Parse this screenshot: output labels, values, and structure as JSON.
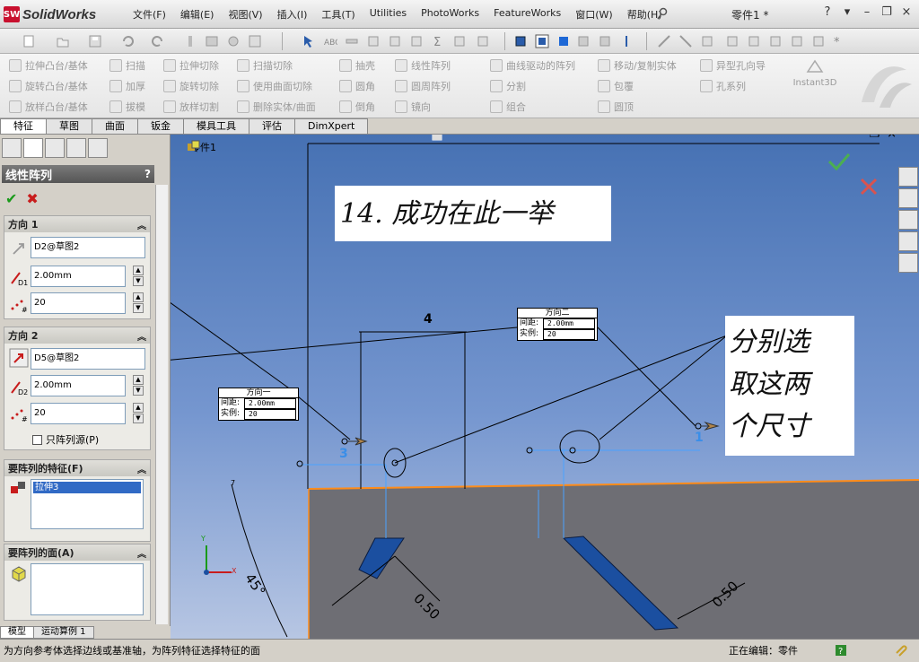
{
  "app": {
    "logo_mark": "SW",
    "logo_text": "SolidWorks",
    "doc_title": "零件1 *",
    "menu": [
      "文件(F)",
      "编辑(E)",
      "视图(V)",
      "插入(I)",
      "工具(T)",
      "Utilities",
      "PhotoWorks",
      "FeatureWorks",
      "窗口(W)",
      "帮助(H)"
    ],
    "window_controls": [
      "?",
      "▾",
      "–",
      "❐",
      "×"
    ]
  },
  "commands": {
    "col1": [
      "拉伸凸台/基体",
      "旋转凸台/基体",
      "放样凸台/基体"
    ],
    "col2": [
      "扫描",
      "加厚",
      "拔模"
    ],
    "col3": [
      "拉伸切除",
      "旋转切除",
      "放样切割"
    ],
    "col4": [
      "扫描切除",
      "使用曲面切除",
      "删除实体/曲面"
    ],
    "col5": [
      "抽壳",
      "圆角",
      "倒角"
    ],
    "col6": [
      "线性阵列",
      "圆周阵列",
      "镜向"
    ],
    "col7": [
      "曲线驱动的阵列",
      "分割",
      "组合"
    ],
    "col8": [
      "移动/复制实体",
      "包覆",
      "圆顶"
    ],
    "col9": [
      "异型孔向导",
      "孔系列"
    ],
    "instant3d": "Instant3D"
  },
  "tabs": [
    "特征",
    "草图",
    "曲面",
    "钣金",
    "模具工具",
    "评估",
    "DimXpert"
  ],
  "property_manager": {
    "title": "线性阵列",
    "help": "?",
    "ok": "✔",
    "cancel": "✖",
    "direction1": {
      "label": "方向 1",
      "reference": "D2@草图2",
      "spacing": "2.00mm",
      "count": "20",
      "spacing_icon_label": "D1"
    },
    "direction2": {
      "label": "方向 2",
      "reference": "D5@草图2",
      "spacing": "2.00mm",
      "count": "20",
      "spacing_icon_label": "D2",
      "pattern_seed_only": "只阵列源(P)"
    },
    "features_to_pattern": {
      "label": "要阵列的特征(F)",
      "items": [
        "拉伸3"
      ]
    },
    "faces_to_pattern": {
      "label": "要阵列的面(A)"
    }
  },
  "left_bottom_tabs": [
    "模型",
    "运动算例 1"
  ],
  "viewport": {
    "tree_root": "零件1",
    "annotation_title": "14. 成功在此一举",
    "annotation_side": [
      "分别选",
      "取这两",
      "个尺寸"
    ],
    "callout1": {
      "title": "方向一",
      "spacing_label": "间距:",
      "spacing": "2.00mm",
      "count_label": "实例:",
      "count": "20"
    },
    "callout2": {
      "title": "方向二",
      "spacing_label": "间距:",
      "spacing": "2.00mm",
      "count_label": "实例:",
      "count": "20"
    },
    "dim_top": "4",
    "dim_left_label": "3",
    "dim_right_label": "1",
    "dim_050_left": "0.50",
    "dim_050_right": "0.50",
    "dim_angle": "45°",
    "dim_7": "7",
    "axis_y": "Y",
    "axis_x": "X"
  },
  "status": {
    "message": "为方向参考体选择边线或基准轴，为阵列特征选择特征的面",
    "editing": "正在编辑：零件"
  },
  "colors": {
    "accent_red": "#c81c1c",
    "ok_green": "#1a9a1a",
    "viewport_top": "#4671b3",
    "model_face": "#6e6e74",
    "edge_orange": "#ff8c1a",
    "feature_blue": "#1b4fa0"
  }
}
